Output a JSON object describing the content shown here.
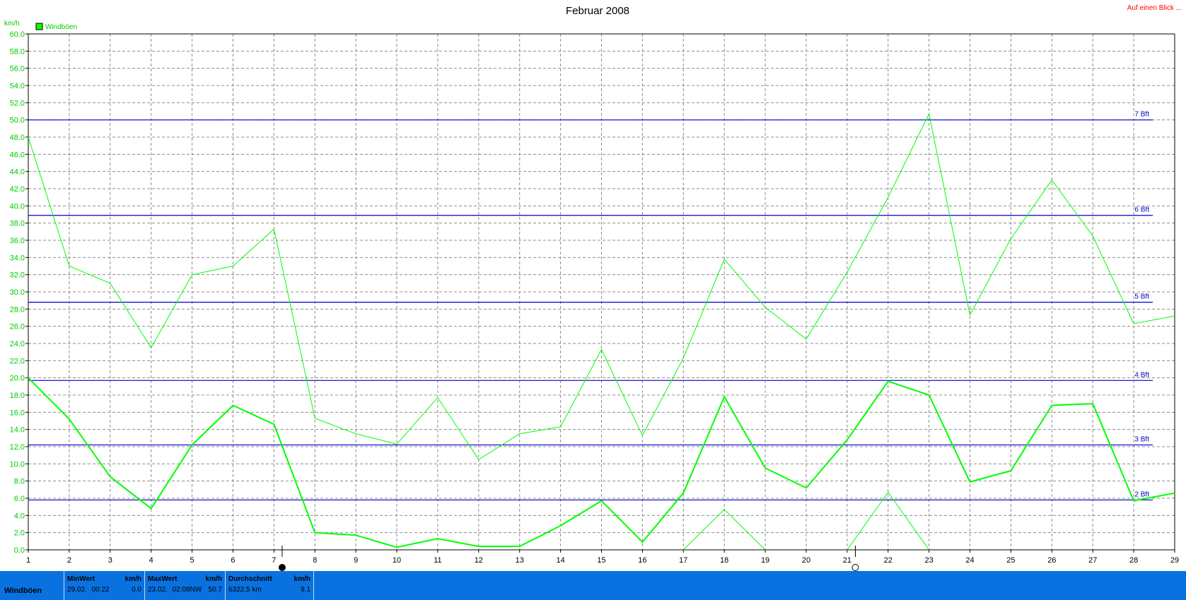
{
  "header": {
    "link_label": "Auf einen Blick ..."
  },
  "chart_data": {
    "type": "line",
    "title": "Februar 2008",
    "ylabel": "km/h",
    "ylim": [
      0,
      60
    ],
    "xlim": [
      1,
      29
    ],
    "x_ticks": [
      "1",
      "2",
      "3",
      "4",
      "5",
      "6",
      "7",
      "8",
      "9",
      "10",
      "11",
      "12",
      "13",
      "14",
      "15",
      "16",
      "17",
      "18",
      "19",
      "20",
      "21",
      "22",
      "23",
      "24",
      "25",
      "26",
      "27",
      "28",
      "29"
    ],
    "y_ticks": [
      "0.0",
      "2.0",
      "4.0",
      "6.0",
      "8.0",
      "10.0",
      "12.0",
      "14.0",
      "16.0",
      "18.0",
      "20.0",
      "22.0",
      "24.0",
      "26.0",
      "28.0",
      "30.0",
      "32.0",
      "34.0",
      "36.0",
      "38.0",
      "40.0",
      "42.0",
      "44.0",
      "46.0",
      "48.0",
      "50.0",
      "52.0",
      "54.0",
      "56.0",
      "58.0",
      "60.0"
    ],
    "grid": true,
    "legend": {
      "position": "top-left",
      "entries": [
        {
          "label": "Windböen",
          "color": "#00ff00"
        }
      ]
    },
    "reference_lines": [
      {
        "label": "2 Bft",
        "value": 5.8
      },
      {
        "label": "3 Bft",
        "value": 12.2
      },
      {
        "label": "4 Bft",
        "value": 19.7
      },
      {
        "label": "5 Bft",
        "value": 28.8
      },
      {
        "label": "6 Bft",
        "value": 38.9
      },
      {
        "label": "7 Bft",
        "value": 50.0
      }
    ],
    "moon_markers": [
      {
        "phase": "new",
        "x": 7.2
      },
      {
        "phase": "full",
        "x": 21.2
      }
    ],
    "series": [
      {
        "name": "Windböen",
        "role": "max",
        "color": "#00ff00",
        "width": 1,
        "x": [
          1,
          2,
          3,
          4,
          5,
          6,
          7,
          8,
          9,
          10,
          11,
          12,
          13,
          14,
          15,
          16,
          17,
          18,
          19,
          20,
          21,
          22,
          23,
          24,
          25,
          26,
          27,
          28,
          29
        ],
        "values": [
          48.0,
          33.0,
          31.0,
          23.5,
          32.0,
          33.0,
          37.3,
          15.3,
          13.5,
          12.3,
          17.7,
          10.5,
          13.5,
          14.3,
          23.3,
          13.3,
          22.3,
          33.8,
          28.2,
          24.5,
          32.3,
          41.0,
          50.7,
          27.3,
          36.2,
          43.0,
          36.5,
          26.3,
          27.2
        ]
      },
      {
        "name": "Windböen",
        "role": "mean",
        "color": "#00ff00",
        "width": 2,
        "x": [
          1,
          2,
          3,
          4,
          5,
          6,
          7,
          8,
          9,
          10,
          11,
          12,
          13,
          14,
          15,
          16,
          17,
          18,
          19,
          20,
          21,
          22,
          23,
          24,
          25,
          26,
          27,
          28,
          29
        ],
        "values": [
          20.0,
          15.2,
          8.5,
          4.8,
          12.2,
          16.8,
          14.6,
          2.0,
          1.7,
          0.3,
          1.3,
          0.4,
          0.4,
          2.8,
          5.7,
          0.9,
          6.6,
          17.8,
          9.5,
          7.2,
          12.8,
          19.6,
          18.0,
          7.9,
          9.2,
          16.8,
          17.0,
          5.7,
          6.6
        ]
      },
      {
        "name": "Windböen",
        "role": "min",
        "color": "#00ff00",
        "width": 1,
        "x": [
          17,
          18,
          19
        ],
        "values": [
          0.0,
          4.7,
          0.0
        ]
      },
      {
        "name": "Windböen",
        "role": "min",
        "color": "#00ff00",
        "width": 1,
        "x": [
          21,
          22,
          23
        ],
        "values": [
          0.0,
          6.7,
          0.0
        ]
      }
    ]
  },
  "footer": {
    "row_label": "Windböen",
    "min": {
      "header": "MinWert",
      "unit": "km/h",
      "date": "29.02.",
      "time": "00:22",
      "value": "0.0"
    },
    "max": {
      "header": "MaxWert",
      "unit": "km/h",
      "date": "23.02.",
      "time": "02:08",
      "dir": "NW",
      "value": "50.7"
    },
    "avg": {
      "header": "Durchschnitt",
      "unit": "km/h",
      "distance": "6322.5 km",
      "value": "9.1"
    }
  }
}
